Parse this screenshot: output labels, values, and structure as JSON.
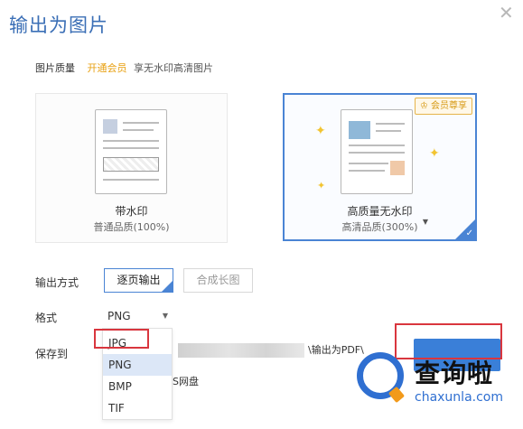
{
  "dialog": {
    "title": "输出为图片",
    "close_icon": "close-icon"
  },
  "quality": {
    "label": "图片质量",
    "vip_link": "开通会员",
    "hint": "享无水印高清图片"
  },
  "cards": {
    "plain": {
      "title": "带水印",
      "subtitle": "普通品质(100%)"
    },
    "hq": {
      "badge": "会员尊享",
      "title": "高质量无水印",
      "subtitle": "高清品质(300%)"
    }
  },
  "output_mode": {
    "label": "输出方式",
    "option_per_page": "逐页输出",
    "option_long": "合成长图"
  },
  "format": {
    "label": "格式",
    "selected": "PNG",
    "options": [
      "JPG",
      "PNG",
      "BMP",
      "TIF"
    ]
  },
  "save_to": {
    "label": "保存到",
    "path_tail": "\\输出为PDF\\",
    "netdisk": "S网盘"
  },
  "brand_watermark": {
    "cn": "查询啦",
    "en": "chaxunla.com"
  },
  "colors": {
    "accent": "#4a84d4",
    "title": "#3b6fb6",
    "vip": "#e8a010",
    "highlight_box": "#d9363e",
    "watermark_blue": "#2f6fd1",
    "watermark_orange": "#f29a1b"
  }
}
